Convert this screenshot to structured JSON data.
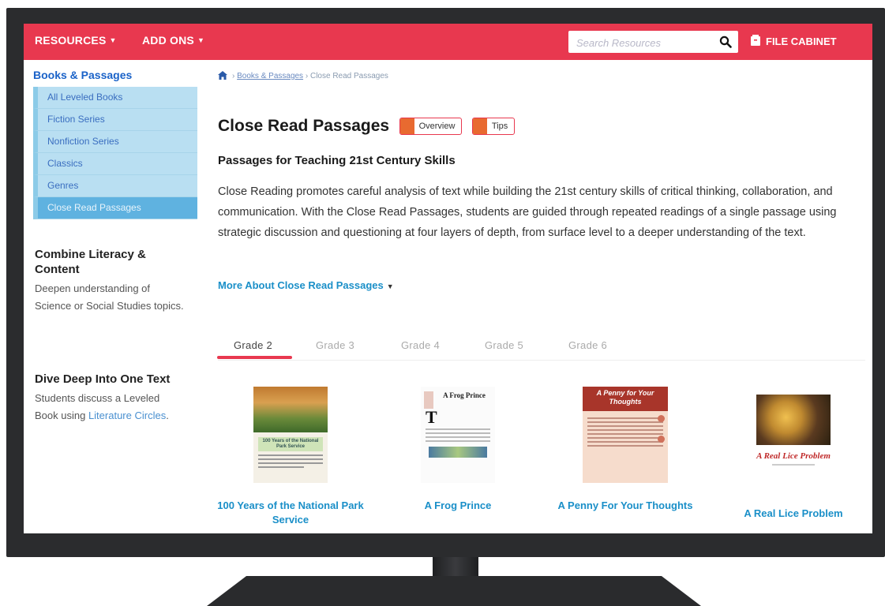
{
  "topbar": {
    "menu": [
      {
        "label": "RESOURCES",
        "caret": "▼"
      },
      {
        "label": "ADD ONS",
        "caret": "▼"
      }
    ],
    "search_placeholder": "Search Resources",
    "search_icon": "search-icon",
    "file_cabinet": "FILE CABINET",
    "bar_color": "#e8384f"
  },
  "sidebar": {
    "title": "Books & Passages",
    "items": [
      {
        "label": "All Leveled Books"
      },
      {
        "label": "Fiction Series"
      },
      {
        "label": "Nonfiction Series"
      },
      {
        "label": "Classics"
      },
      {
        "label": "Genres"
      },
      {
        "label": "Close Read Passages",
        "active": true
      }
    ],
    "blocks": [
      {
        "title": "Combine Literacy & Content",
        "text": "Deepen understanding of Science or Social Studies topics."
      },
      {
        "title": "Dive Deep Into One Text",
        "text": "Students discuss a Leveled Book using ",
        "link": "Literature Circles",
        "suffix": "."
      }
    ]
  },
  "breadcrumb": {
    "home_icon": "home-icon",
    "link": "Books & Passages",
    "separator": "›",
    "current": "Close Read Passages"
  },
  "main": {
    "title": "Close Read Passages",
    "chips": [
      {
        "label": "Overview"
      },
      {
        "label": "Tips"
      }
    ],
    "subtitle": "Passages for Teaching 21st Century Skills",
    "description": "Close Reading promotes careful analysis of text while building the 21st century skills of critical thinking, collaboration, and communication. With the Close Read Passages, students are guided through repeated readings of a single passage using strategic discussion and questioning at four layers of depth, from surface level to a deeper understanding of the text.",
    "more_link": "More About Close Read Passages",
    "more_caret": "▼"
  },
  "tabs": [
    {
      "label": "Grade 2",
      "active": true
    },
    {
      "label": "Grade 3"
    },
    {
      "label": "Grade 4"
    },
    {
      "label": "Grade 5"
    },
    {
      "label": "Grade 6"
    }
  ],
  "books": [
    {
      "title": "100 Years of the National Park Service",
      "cover_text": "100 Years of the National Park Service"
    },
    {
      "title": "A Frog Prince",
      "cover_text": "A Frog Prince"
    },
    {
      "title": "A Penny For Your Thoughts",
      "cover_text": "A Penny for Your Thoughts"
    },
    {
      "title": "A Real Lice Problem",
      "cover_text": "A Real Lice Problem"
    }
  ]
}
